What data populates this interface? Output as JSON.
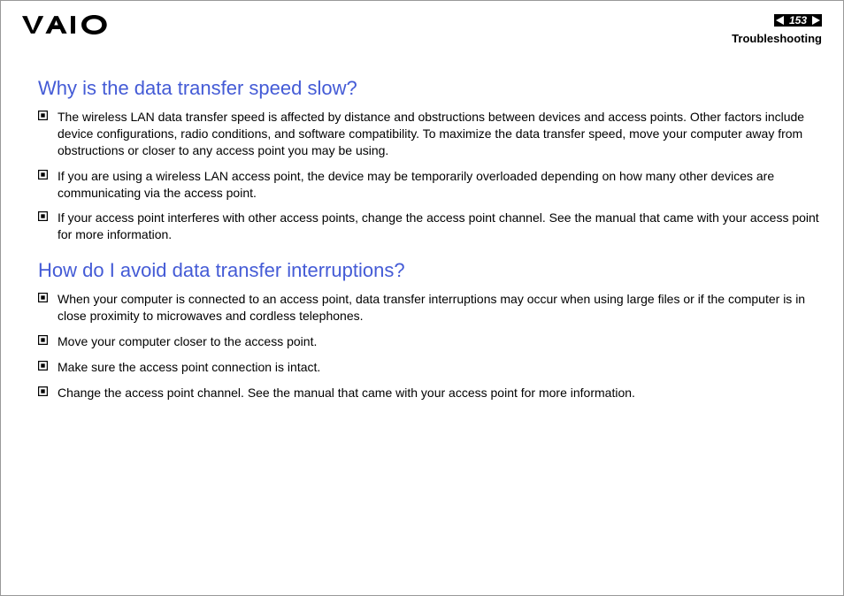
{
  "header": {
    "page_number": "153",
    "section": "Troubleshooting"
  },
  "sections": [
    {
      "heading": "Why is the data transfer speed slow?",
      "items": [
        "The wireless LAN data transfer speed is affected by distance and obstructions between devices and access points. Other factors include device configurations, radio conditions, and software compatibility. To maximize the data transfer speed, move your computer away from obstructions or closer to any access point you may be using.",
        "If you are using a wireless LAN access point, the device may be temporarily overloaded depending on how many other devices are communicating via the access point.",
        "If your access point interferes with other access points, change the access point channel. See the manual that came with your access point for more information."
      ]
    },
    {
      "heading": "How do I avoid data transfer interruptions?",
      "items": [
        "When your computer is connected to an access point, data transfer interruptions may occur when using large files or if the computer is in close proximity to microwaves and cordless telephones.",
        "Move your computer closer to the access point.",
        "Make sure the access point connection is intact.",
        "Change the access point channel. See the manual that came with your access point for more information."
      ]
    }
  ]
}
